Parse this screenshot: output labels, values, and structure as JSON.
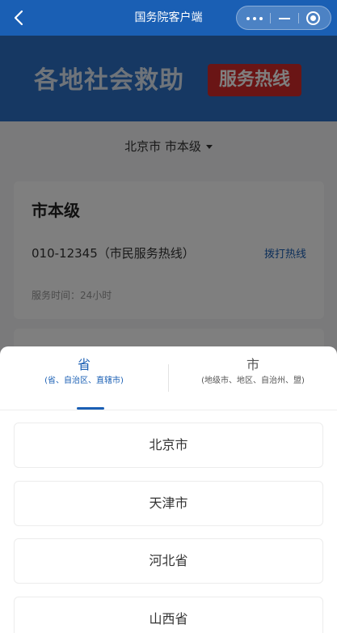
{
  "navbar": {
    "title": "国务院客户端",
    "back_icon": "chevron-left-icon",
    "capsule": {
      "more_icon": "more-dots-icon",
      "minimize_icon": "minimize-icon",
      "close_icon": "target-close-icon"
    }
  },
  "banner": {
    "title": "各地社会救助",
    "badge": "服务热线",
    "colors": {
      "background": "#2c71c6",
      "badge": "#d52a2a"
    }
  },
  "region_selector": {
    "label": "北京市 市本级",
    "caret_icon": "caret-down-icon"
  },
  "info_card": {
    "title": "市本级",
    "phone": "010-12345（市民服务热线）",
    "call_button": "拨打热线",
    "hours": "服务时间：24小时"
  },
  "sheet": {
    "tabs": [
      {
        "label": "省",
        "sub": "(省、自治区、直辖市)",
        "active": true
      },
      {
        "label": "市",
        "sub": "(地级市、地区、自治州、盟)",
        "active": false
      }
    ],
    "options": [
      "北京市",
      "天津市",
      "河北省",
      "山西省"
    ]
  },
  "colors": {
    "accent": "#1a5fb4",
    "overlay": "rgba(0,0,0,0.5)"
  }
}
